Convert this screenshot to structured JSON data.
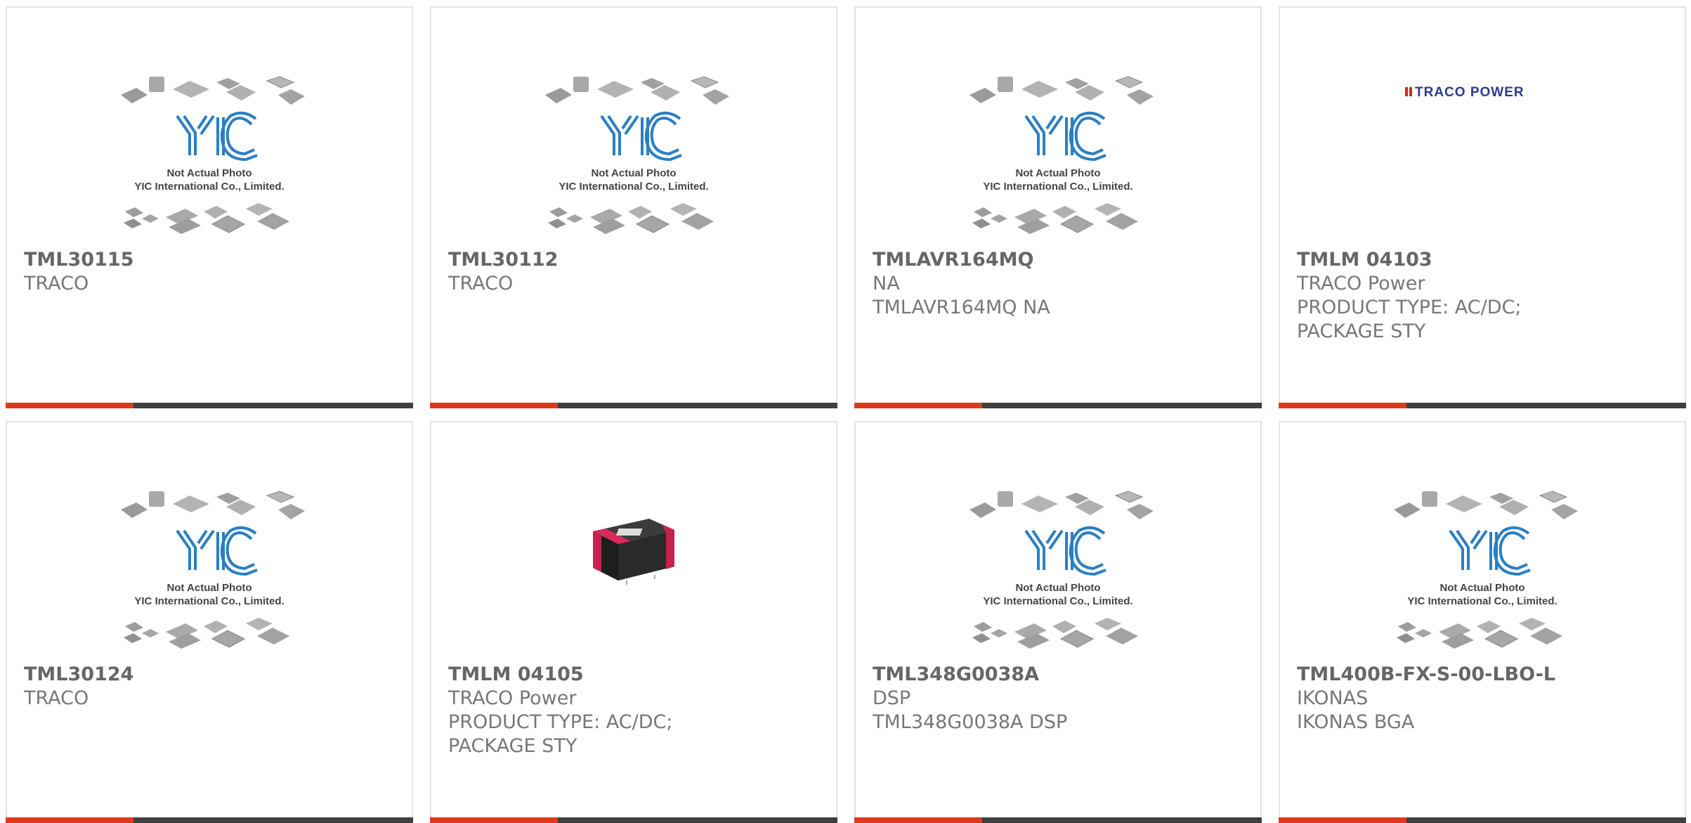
{
  "placeholder": {
    "caption_line1": "Not Actual Photo",
    "caption_line2": "YIC International Co., Limited.",
    "logo": "YIC"
  },
  "brand_logo": {
    "text": "TRACO POWER"
  },
  "products": [
    {
      "part": "TML30115",
      "manufacturer": "TRACO",
      "description": "",
      "image": "yic-placeholder"
    },
    {
      "part": "TML30112",
      "manufacturer": "TRACO",
      "description": "",
      "image": "yic-placeholder"
    },
    {
      "part": "TMLAVR164MQ",
      "manufacturer": "NA",
      "description": "TMLAVR164MQ NA",
      "image": "yic-placeholder"
    },
    {
      "part": "TMLM 04103",
      "manufacturer": "TRACO Power",
      "description": "PRODUCT TYPE: AC/DC;",
      "description2": "PACKAGE STY",
      "image": "traco-power-logo"
    },
    {
      "part": "TML30124",
      "manufacturer": "TRACO",
      "description": "",
      "image": "yic-placeholder"
    },
    {
      "part": "TMLM 04105",
      "manufacturer": "TRACO Power",
      "description": "PRODUCT TYPE: AC/DC;",
      "description2": "PACKAGE STY",
      "image": "power-module-photo"
    },
    {
      "part": "TML348G0038A",
      "manufacturer": "DSP",
      "description": "TML348G0038A DSP",
      "image": "yic-placeholder"
    },
    {
      "part": "TML400B-FX-S-00-LBO-L",
      "manufacturer": "IKONAS",
      "description": "IKONAS BGA",
      "image": "yic-placeholder"
    }
  ],
  "colors": {
    "accent_bar": "#e0381b",
    "dark_bar": "#3f3f3f",
    "text": "#666666"
  }
}
